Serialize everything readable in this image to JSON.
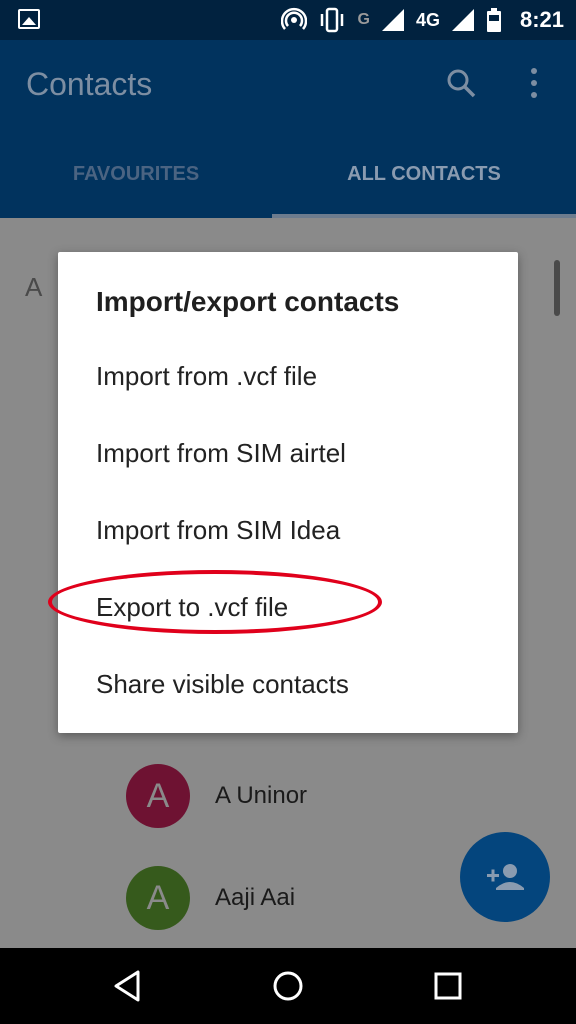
{
  "status_bar": {
    "network_letter": "G",
    "network_type": "4G",
    "time": "8:21",
    "icons": [
      "gallery-icon",
      "hotspot-icon",
      "vibrate-icon",
      "signal-icon",
      "battery-icon"
    ]
  },
  "app_bar": {
    "title": "Contacts",
    "tabs": [
      {
        "label": "FAVOURITES",
        "selected": false
      },
      {
        "label": "ALL CONTACTS",
        "selected": true
      }
    ]
  },
  "list": {
    "section_letter": "A",
    "contacts": [
      {
        "initial": "A",
        "name": "A Uninor",
        "color": "#6e1232"
      },
      {
        "initial": "A",
        "name": "Aaji Aai",
        "color": "#365a1c"
      }
    ]
  },
  "dialog": {
    "title": "Import/export contacts",
    "items": [
      "Import from .vcf file",
      "Import from SIM airtel",
      "Import from SIM Idea",
      "Export to .vcf file",
      "Share visible contacts"
    ],
    "highlighted_item": "Export to .vcf file",
    "highlight_color": "#e0001b"
  },
  "colors": {
    "status_bar": "#01223f",
    "app_bar": "#01335e",
    "fab": "#04457d",
    "scrim": "#8a8a8a"
  }
}
